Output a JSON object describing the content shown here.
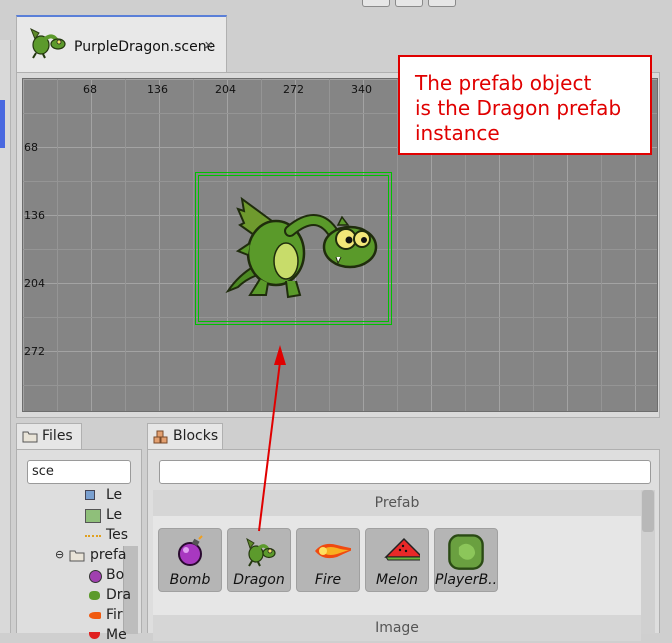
{
  "editor": {
    "tab_title": "PurpleDragon.scene",
    "tab_close": "✕"
  },
  "scene": {
    "ruler_x": [
      "68",
      "136",
      "204",
      "272",
      "340"
    ],
    "ruler_y": [
      "68",
      "136",
      "204",
      "272"
    ]
  },
  "annotation": {
    "line1": "The prefab object",
    "line2": "is the Dragon prefab",
    "line3": "instance"
  },
  "files_panel": {
    "tab_label": "Files",
    "search_value": "sce",
    "items": [
      {
        "label": "Le"
      },
      {
        "label": "Le"
      },
      {
        "label": "Tes"
      },
      {
        "label": "prefa"
      },
      {
        "label": "Bo"
      },
      {
        "label": "Dra"
      },
      {
        "label": "Fir"
      },
      {
        "label": "Me"
      }
    ]
  },
  "blocks_panel": {
    "tab_label": "Blocks",
    "search_value": "",
    "section_prefab": "Prefab",
    "section_image": "Image",
    "items": [
      {
        "label": "Bomb"
      },
      {
        "label": "Dragon"
      },
      {
        "label": "Fire"
      },
      {
        "label": "Melon"
      },
      {
        "label": "PlayerB.."
      }
    ]
  }
}
